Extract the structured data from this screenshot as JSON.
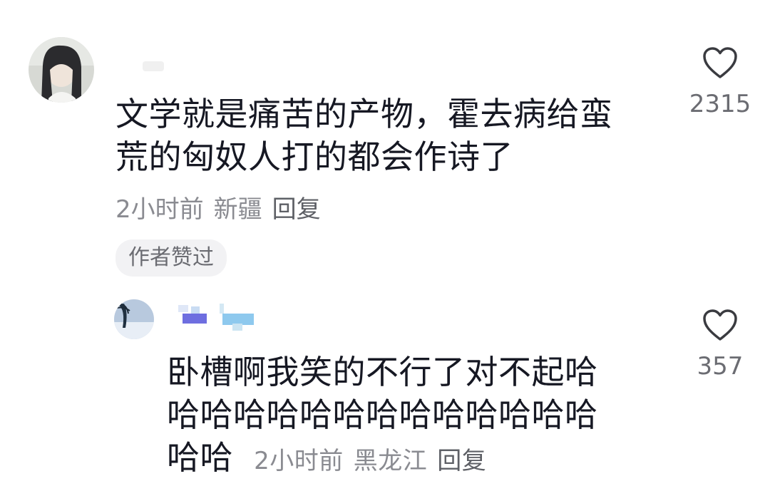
{
  "comments": [
    {
      "username": "",
      "text_lines": [
        "文学就是痛苦的产物，霍去病给蛮",
        "荒的匈奴人打的都会作诗了"
      ],
      "time": "2小时前",
      "location": "新疆",
      "reply_label": "回复",
      "badge": "作者赞过",
      "likes": "2315"
    },
    {
      "username": "",
      "text_lines": [
        "卧槽啊我笑的不行了对不起哈",
        "哈哈哈哈哈哈哈哈哈哈哈哈哈",
        "哈哈"
      ],
      "time": "2小时前",
      "location": "黑龙江",
      "reply_label": "回复",
      "likes": "357"
    }
  ],
  "icons": {
    "like": "heart-outline-icon"
  },
  "colors": {
    "text": "#161823",
    "meta": "#8a8b91",
    "badge_bg": "#f2f2f4"
  }
}
